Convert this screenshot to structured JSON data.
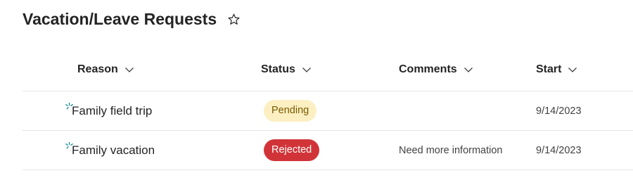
{
  "list": {
    "title": "Vacation/Leave Requests",
    "favorite_icon": "star-outline-icon"
  },
  "columns": [
    {
      "label": "Reason",
      "icon": "chevron-down-icon"
    },
    {
      "label": "Status",
      "icon": "chevron-down-icon"
    },
    {
      "label": "Comments",
      "icon": "chevron-down-icon"
    },
    {
      "label": "Start",
      "icon": "chevron-down-icon"
    }
  ],
  "rows": [
    {
      "reason": "Family field trip",
      "status": "Pending",
      "comments": "",
      "start": "9/14/2023",
      "new_icon": "new-item-icon"
    },
    {
      "reason": "Family vacation",
      "status": "Rejected",
      "comments": "Need more information",
      "start": "9/14/2023",
      "new_icon": "new-item-icon"
    }
  ],
  "colors": {
    "pending_bg": "#fcefc2",
    "pending_text": "#7a5a00",
    "rejected_bg": "#d13438",
    "rejected_text": "#ffffff",
    "new_indicator": "#038387"
  }
}
